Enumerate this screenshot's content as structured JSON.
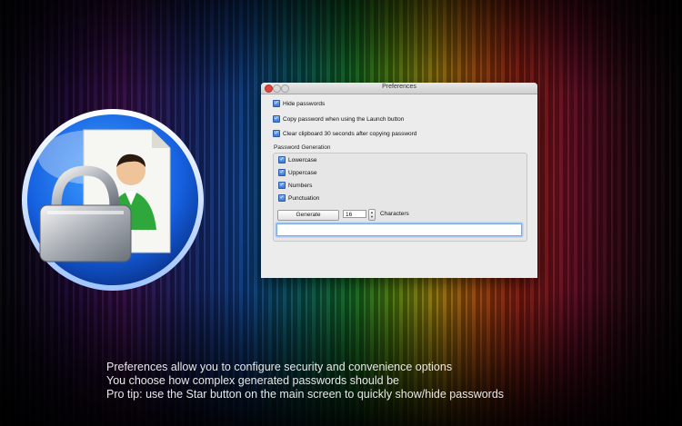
{
  "window": {
    "title": "Preferences"
  },
  "options": [
    {
      "label": "Hide passwords",
      "checked": true
    },
    {
      "label": "Copy password when using the Launch button",
      "checked": true
    },
    {
      "label": "Clear clipboard 30 seconds after copying password",
      "checked": true
    }
  ],
  "generation": {
    "group_label": "Password Generation",
    "character_sets": [
      {
        "label": "Lowercase",
        "checked": true
      },
      {
        "label": "Uppercase",
        "checked": true
      },
      {
        "label": "Numbers",
        "checked": true
      },
      {
        "label": "Punctuation",
        "checked": true
      }
    ],
    "generate_label": "Generate",
    "length_value": "16",
    "characters_label": "Characters",
    "generated_password": ""
  },
  "caption": {
    "line1": "Preferences allow you to configure security and convenience options",
    "line2": "You choose how complex generated passwords should be",
    "line3": "Pro tip: use the Star button on the main screen to quickly show/hide passwords"
  },
  "icons": {
    "app": "padlock-person-document-icon",
    "checkbox": "checkmark-icon"
  },
  "colors": {
    "accent": "#3a78d8",
    "close_button": "#e0443e"
  }
}
